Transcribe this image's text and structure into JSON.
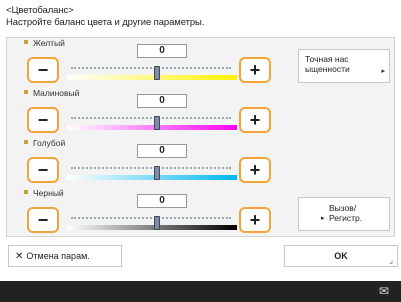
{
  "header": {
    "title": "<Цветобаланс>",
    "subtitle": "Настройте баланс цвета и другие параметры."
  },
  "rows": [
    {
      "label": "Желтый",
      "value": "0",
      "level": 0.5
    },
    {
      "label": "Малиновый",
      "value": "0",
      "level": 0.5
    },
    {
      "label": "Голубой",
      "value": "0",
      "level": 0.5
    },
    {
      "label": "Черный",
      "value": "0",
      "level": 0.5
    }
  ],
  "step": {
    "minus": "−",
    "plus": "+"
  },
  "side": {
    "saturation_line1": "Точная нас",
    "saturation_line2": "ыщенности",
    "recall_line1": "Вызов/",
    "recall_line2": "Регистр."
  },
  "footer": {
    "cancel_label": "Отмена парам.",
    "ok_label": "OK"
  },
  "colors": {
    "yellow": "#fff200",
    "magenta": "#ff00ff",
    "cyan": "#00b7ef",
    "black": "#000000",
    "accent_border": "#f2a43a"
  },
  "icons": {
    "cancel": "close-icon",
    "arrow": "chevron-right-icon",
    "status": "notification-icon"
  }
}
